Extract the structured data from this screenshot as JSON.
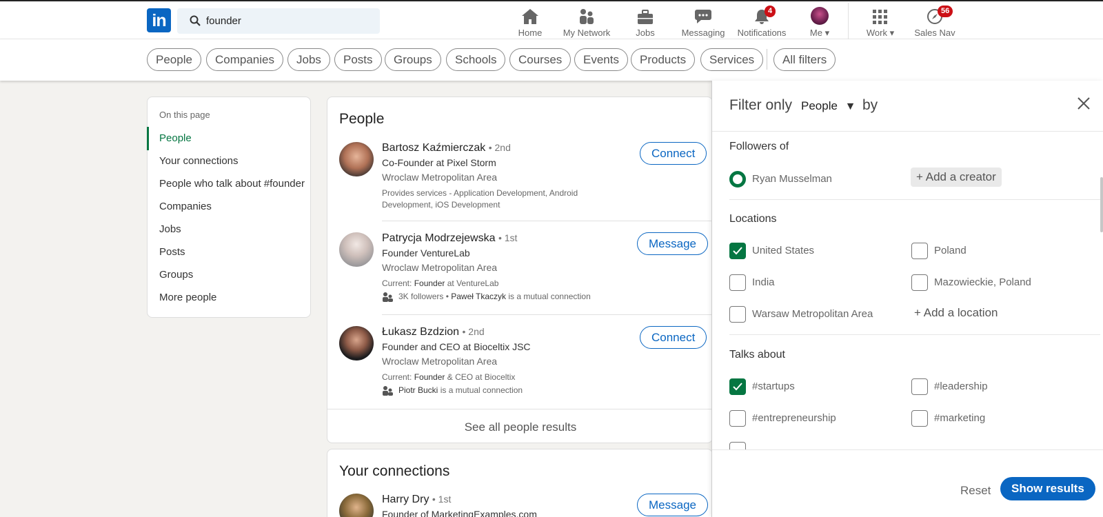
{
  "search": {
    "value": "founder"
  },
  "nav": {
    "items": [
      {
        "label": "Home"
      },
      {
        "label": "My Network"
      },
      {
        "label": "Jobs"
      },
      {
        "label": "Messaging"
      },
      {
        "label": "Notifications",
        "badge": "4"
      },
      {
        "label": "Me"
      },
      {
        "label": "Work"
      },
      {
        "label": "Sales Nav",
        "badge": "56"
      }
    ]
  },
  "pills": [
    "People",
    "Companies",
    "Jobs",
    "Posts",
    "Groups",
    "Schools",
    "Courses",
    "Events",
    "Products",
    "Services",
    "All filters"
  ],
  "leftnav": {
    "caption": "On this page",
    "items": [
      "People",
      "Your connections",
      "People who talk about #founder",
      "Companies",
      "Jobs",
      "Posts",
      "Groups",
      "More people"
    ]
  },
  "people_card": {
    "title": "People",
    "results": [
      {
        "name": "Bartosz Kaźmierczak",
        "degree": "• 2nd",
        "headline": "Co-Founder at Pixel Storm",
        "location": "Wroclaw Metropolitan Area",
        "extra1": "Provides services - Application Development, Android",
        "extra2": "Development, iOS Development",
        "action": "Connect"
      },
      {
        "name": "Patrycja Modrzejewska",
        "degree": "• 1st",
        "headline": "Founder VentureLab",
        "location": "Wroclaw Metropolitan Area",
        "current_prefix": "Current: ",
        "current_bold": "Founder",
        "current_suffix": " at VentureLab",
        "mutual_prefix": "3K followers • ",
        "mutual_bold": "Paweł Tkaczyk",
        "mutual_suffix": " is a mutual connection",
        "action": "Message"
      },
      {
        "name": "Łukasz Bzdzion",
        "degree": "• 2nd",
        "headline": "Founder and CEO at Bioceltix JSC",
        "location": "Wroclaw Metropolitan Area",
        "current_prefix": "Current: ",
        "current_bold": "Founder",
        "current_suffix": " & CEO at Bioceltix",
        "mutual_bold": "Piotr Bucki",
        "mutual_suffix": " is a mutual connection",
        "action": "Connect"
      }
    ],
    "see_all": "See all people results"
  },
  "connections_card": {
    "title": "Your connections",
    "results": [
      {
        "name": "Harry Dry",
        "degree": "• 1st",
        "headline": "Founder of MarketingExamples.com",
        "action": "Message"
      }
    ]
  },
  "filter_panel": {
    "title": "Filter only",
    "dropdown": "People",
    "by": "by",
    "followers": {
      "title": "Followers of",
      "selected": "Ryan Musselman",
      "add": "Add a creator"
    },
    "locations": {
      "title": "Locations",
      "options": [
        {
          "label": "United States",
          "checked": true
        },
        {
          "label": "Poland",
          "checked": false
        },
        {
          "label": "India",
          "checked": false
        },
        {
          "label": "Mazowieckie, Poland",
          "checked": false
        },
        {
          "label": "Warsaw Metropolitan Area",
          "checked": false
        }
      ],
      "add": "Add a location"
    },
    "talks_about": {
      "title": "Talks about",
      "options": [
        {
          "label": "#startups",
          "checked": true
        },
        {
          "label": "#leadership",
          "checked": false
        },
        {
          "label": "#entrepreneurship",
          "checked": false
        },
        {
          "label": "#marketing",
          "checked": false
        }
      ]
    },
    "reset": "Reset",
    "show_results": "Show results"
  },
  "colors": {
    "brand": "#0a66c2",
    "accent_green": "#057642",
    "badge_red": "#cc1016"
  }
}
